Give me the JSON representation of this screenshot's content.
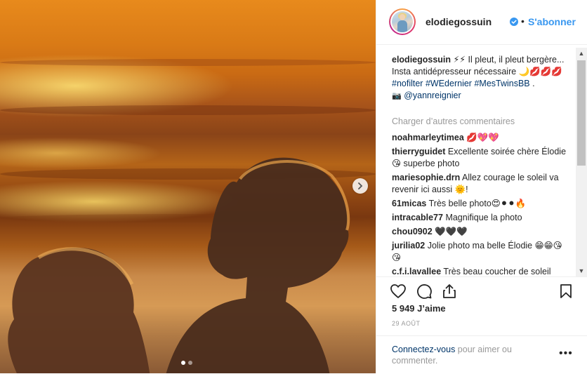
{
  "post": {
    "username": "elodiegossuin",
    "separator": "•",
    "follow_label": "S'abonner",
    "caption_user": "elodiegossuin",
    "caption_text": " ⚡⚡ Il pleut, il pleut bergère... Insta antidépresseur nécessaire 🌙💋💋💋",
    "hashtags": [
      "#nofilter",
      "#WEdernier",
      "#MesTwinsBB"
    ],
    "hashtag_suffix": " .",
    "camera_glyph": "📷",
    "mention": "@yannreignier",
    "load_more": "Charger d’autres commentaires",
    "likes": "5 949 J’aime",
    "date": "29 AOÛT",
    "login_link": "Connectez-vous",
    "login_text": " pour aimer ou commenter.",
    "more_glyph": "•••"
  },
  "comments": [
    {
      "user": "noahmarleytimea",
      "text": " 💋💖💖"
    },
    {
      "user": "thierryguidet",
      "text": " Excellente soirée chère Élodie 😘 superbe photo"
    },
    {
      "user": "mariesophie.drn",
      "text": " Allez courage le soleil va revenir ici aussi 🌞!"
    },
    {
      "user": "61micas",
      "text": " Très belle photo😍⚫⚫🔥"
    },
    {
      "user": "intracable77",
      "text": " Magnifique la photo"
    },
    {
      "user": "chou0902",
      "text": " 🖤🖤🖤"
    },
    {
      "user": "jurilia02",
      "text": " Jolie photo ma belle Élodie 😁😁😘😘"
    },
    {
      "user": "c.f.i.lavallee",
      "text": " Très beau coucher de soleil"
    }
  ],
  "colors": {
    "link": "#3897f0",
    "hashtag": "#003569",
    "muted": "#999999"
  },
  "icons": [
    "verified-badge-icon",
    "next-arrow-icon",
    "heart-icon",
    "comment-icon",
    "share-icon",
    "bookmark-icon"
  ]
}
